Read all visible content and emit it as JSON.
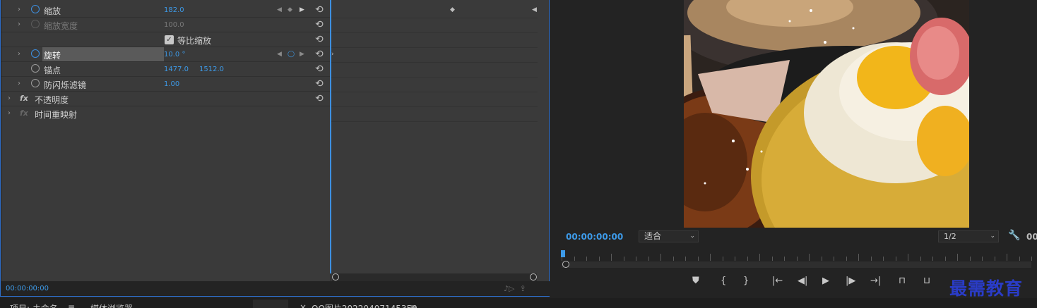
{
  "effect_controls": {
    "rows": [
      {
        "name": "scale",
        "label": "缩放",
        "value": "182.0",
        "active": true,
        "expandable": true
      },
      {
        "name": "scale-width",
        "label": "缩放宽度",
        "value": "100.0",
        "active": false,
        "expandable": true
      },
      {
        "name": "uniform-scale",
        "label": "等比缩放",
        "checked": true
      },
      {
        "name": "rotation",
        "label": "旋转",
        "value": "10.0 °",
        "active": true,
        "expandable": true,
        "selected": true
      },
      {
        "name": "anchor-point",
        "label": "锚点",
        "value_x": "1477.0",
        "value_y": "1512.0",
        "active": false,
        "expandable": false
      },
      {
        "name": "anti-flicker",
        "label": "防闪烁滤镜",
        "value": "1.00",
        "active": false,
        "expandable": true
      },
      {
        "name": "opacity",
        "label": "不透明度",
        "fx": true,
        "expandable": true
      },
      {
        "name": "time-remapping",
        "label": "时间重映射",
        "fx": true,
        "expandable": true
      }
    ],
    "timecode": "00:00:00:00"
  },
  "program_monitor": {
    "timecode": "00:00:00:00",
    "fit_label": "适合",
    "resolution": "1/2",
    "right_timecode": "00"
  },
  "watermark": "最需教育",
  "bottom_tabs": {
    "project": "项目: 未命名",
    "project_menu": "≡",
    "media_browser": "媒体浏览器",
    "sequence": "QQ图片20220407145350",
    "sequence_menu": "≡",
    "sequence_close": "×"
  },
  "colors": {
    "accent": "#3d9ae8",
    "panel": "#3a3a3a",
    "watermark": "#2a3cc8"
  }
}
